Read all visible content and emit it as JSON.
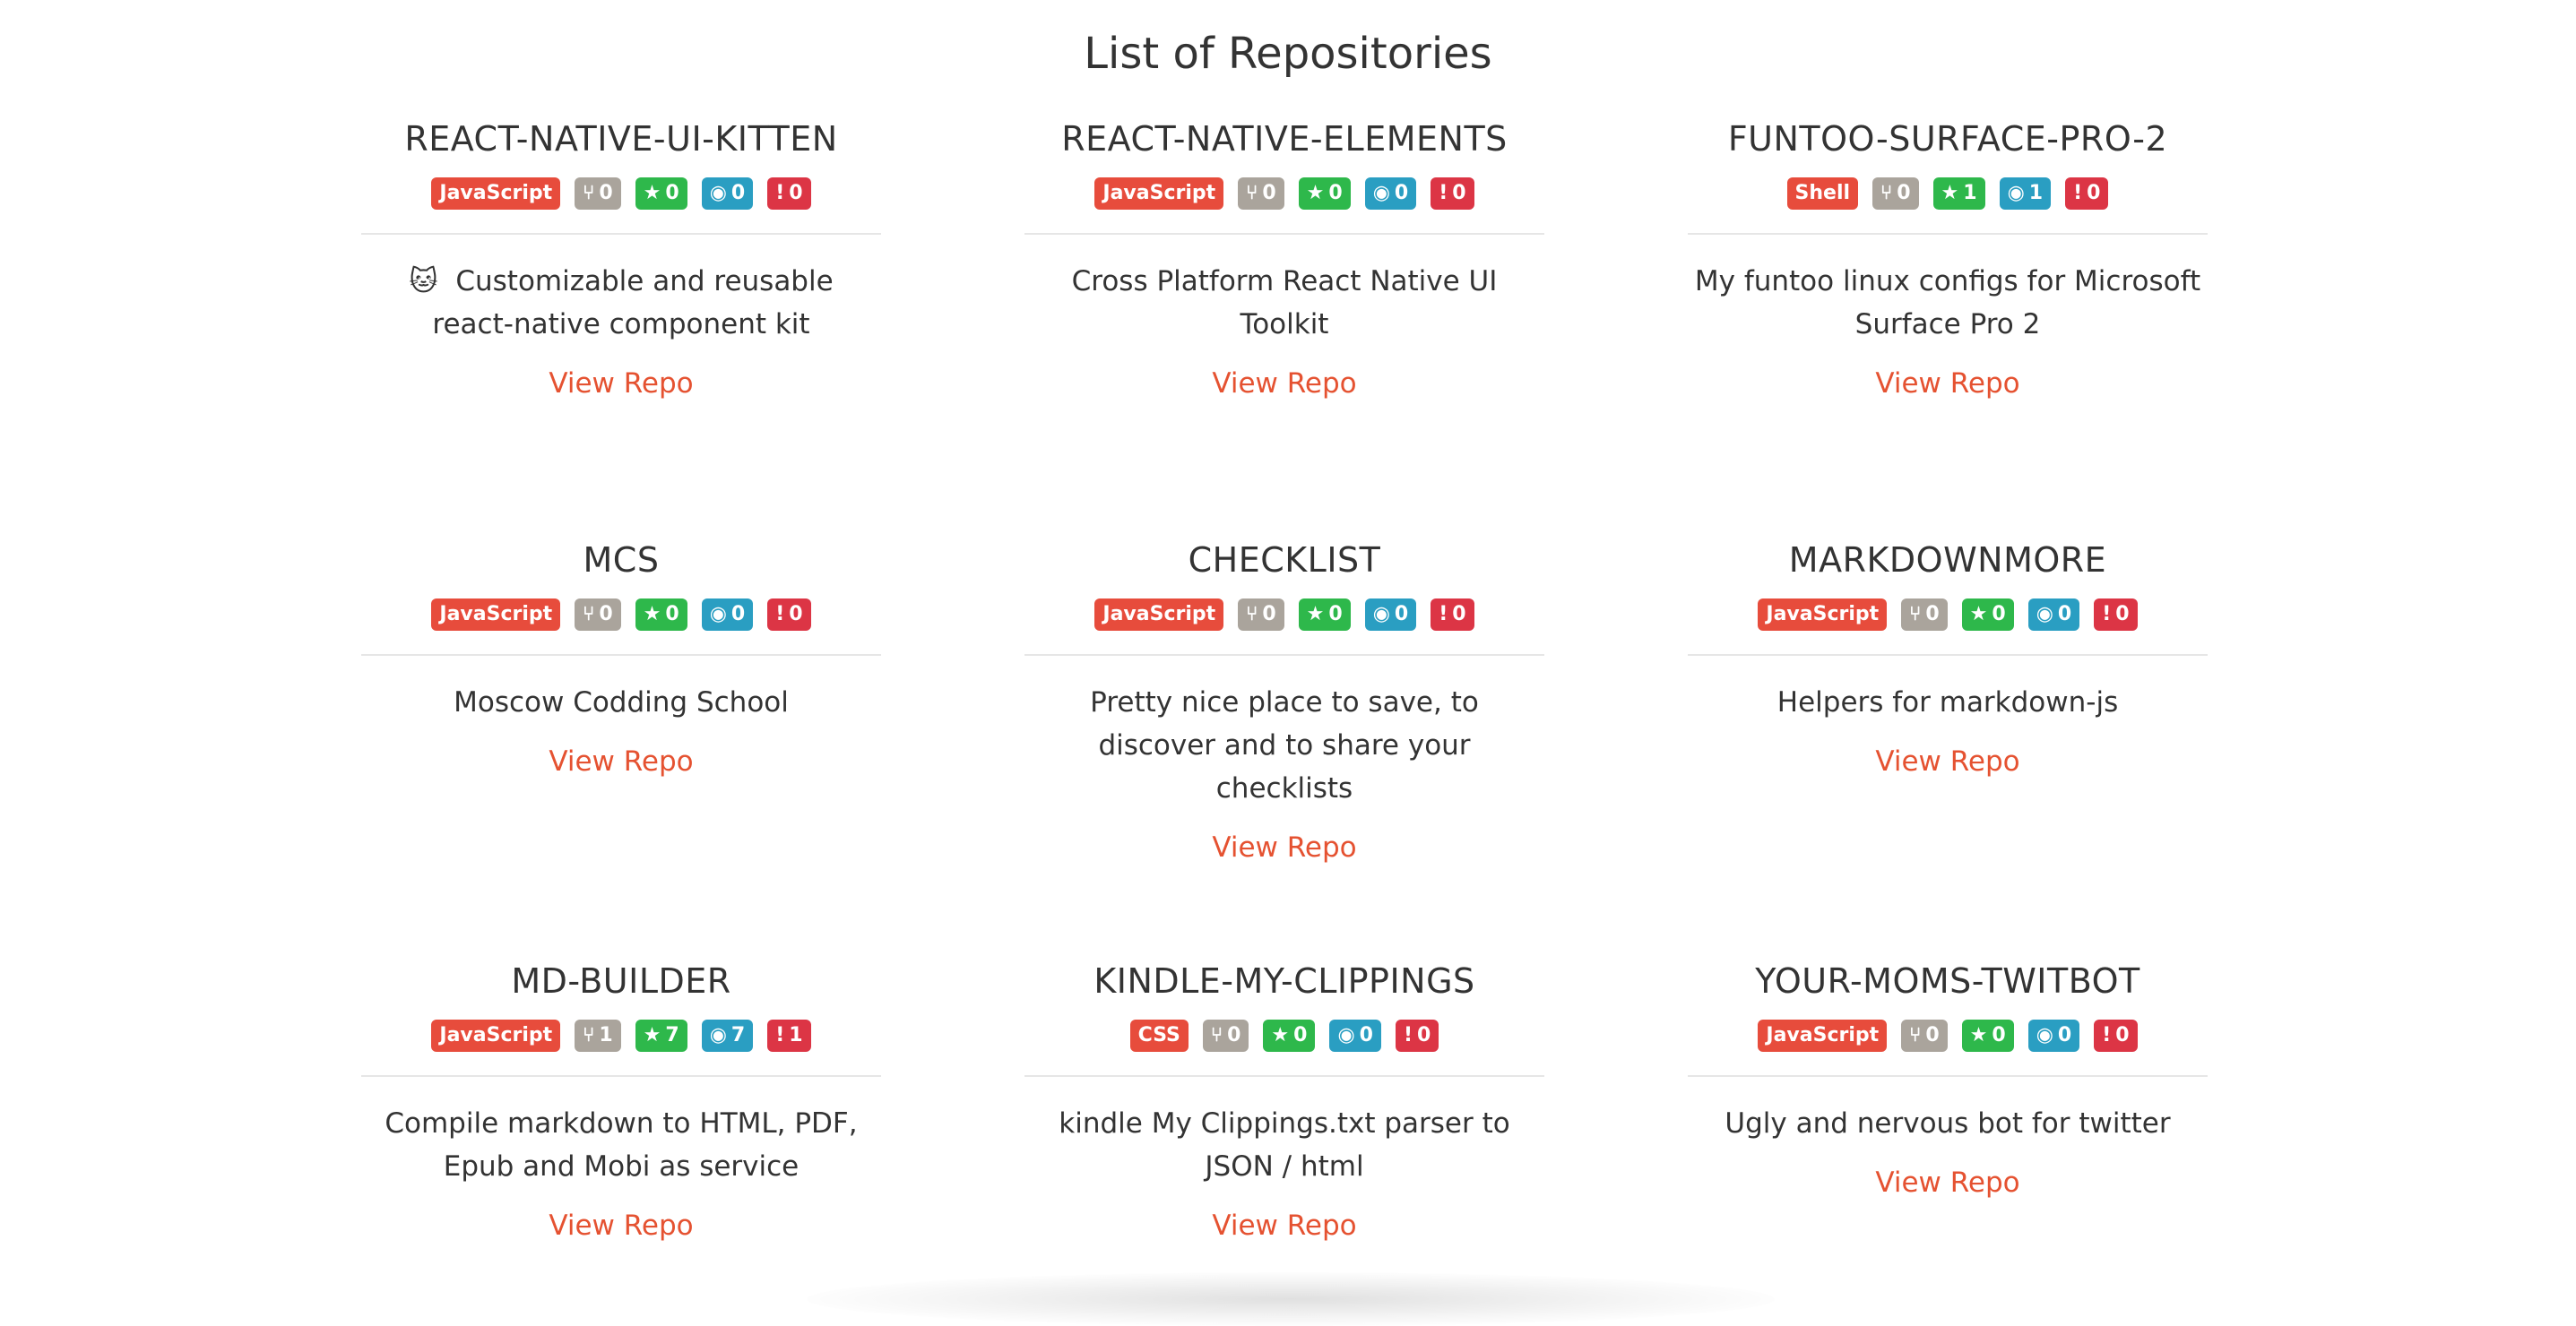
{
  "page": {
    "title": "List of Repositories"
  },
  "common": {
    "view_label": "View Repo"
  },
  "colors": {
    "language_badge": "#e74c3c",
    "forks_badge": "#aaa49c",
    "stars_badge": "#2eb84b",
    "watchers_badge": "#2a9ec2",
    "issues_badge": "#dc3545",
    "link": "#e55231"
  },
  "icons": {
    "forks": "fork-icon",
    "stars": "star-icon",
    "watchers": "eye-icon",
    "issues": "exclamation-icon"
  },
  "repos": [
    {
      "name": "REACT-NATIVE-UI-KITTEN",
      "language": "JavaScript",
      "forks": "0",
      "stars": "0",
      "watchers": "0",
      "issues": "0",
      "emoji": "🐱",
      "description": "Customizable and reusable react-native component kit"
    },
    {
      "name": "REACT-NATIVE-ELEMENTS",
      "language": "JavaScript",
      "forks": "0",
      "stars": "0",
      "watchers": "0",
      "issues": "0",
      "emoji": "",
      "description": "Cross Platform React Native UI Toolkit"
    },
    {
      "name": "FUNTOO-SURFACE-PRO-2",
      "language": "Shell",
      "forks": "0",
      "stars": "1",
      "watchers": "1",
      "issues": "0",
      "emoji": "",
      "description": "My funtoo linux configs for Microsoft Surface Pro 2"
    },
    {
      "name": "MCS",
      "language": "JavaScript",
      "forks": "0",
      "stars": "0",
      "watchers": "0",
      "issues": "0",
      "emoji": "",
      "description": "Moscow Codding School"
    },
    {
      "name": "CHECKLIST",
      "language": "JavaScript",
      "forks": "0",
      "stars": "0",
      "watchers": "0",
      "issues": "0",
      "emoji": "",
      "description": "Pretty nice place to save, to discover and to share your checklists"
    },
    {
      "name": "MARKDOWNMORE",
      "language": "JavaScript",
      "forks": "0",
      "stars": "0",
      "watchers": "0",
      "issues": "0",
      "emoji": "",
      "description": "Helpers for markdown-js"
    },
    {
      "name": "MD-BUILDER",
      "language": "JavaScript",
      "forks": "1",
      "stars": "7",
      "watchers": "7",
      "issues": "1",
      "emoji": "",
      "description": "Compile markdown to HTML, PDF, Epub and Mobi as service"
    },
    {
      "name": "KINDLE-MY-CLIPPINGS",
      "language": "CSS",
      "forks": "0",
      "stars": "0",
      "watchers": "0",
      "issues": "0",
      "emoji": "",
      "description": "kindle My Clippings.txt parser to JSON / html"
    },
    {
      "name": "YOUR-MOMS-TWITBOT",
      "language": "JavaScript",
      "forks": "0",
      "stars": "0",
      "watchers": "0",
      "issues": "0",
      "emoji": "",
      "description": "Ugly and nervous bot for twitter"
    }
  ]
}
